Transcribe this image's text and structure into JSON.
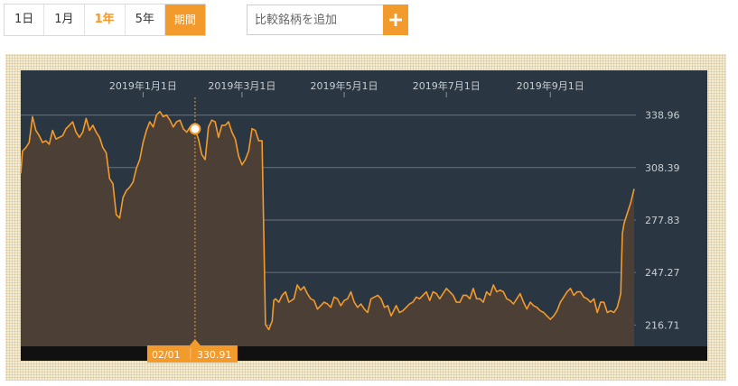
{
  "period_selector": {
    "options": [
      "1日",
      "1月",
      "1年",
      "5年"
    ],
    "active": "1年",
    "custom_label": "期間"
  },
  "add_symbol": {
    "placeholder": "比較銘柄を追加",
    "button_icon": "plus-icon"
  },
  "colors": {
    "accent": "#f39a2c",
    "plot_background": "#2b3643",
    "area_fill": "#4c3f35",
    "gridline": "#6b737c",
    "frame_pattern": "#f4eed7"
  },
  "chart_data": {
    "type": "area",
    "x_tick_labels": [
      "2019年1月1日",
      "2019年3月1日",
      "2019年5月1日",
      "2019年7月1日",
      "2019年9月1日"
    ],
    "y_tick_labels": [
      "338.96",
      "308.39",
      "277.83",
      "247.27",
      "216.71"
    ],
    "y_ticks": [
      338.96,
      308.39,
      277.83,
      247.27,
      216.71
    ],
    "ylim": [
      204.3,
      365
    ],
    "xlim": [
      "2018-10-20",
      "2019-10-21"
    ],
    "grid": true,
    "cursor": {
      "date": "2019-02-01",
      "date_label": "02/01",
      "value_label": "330.91",
      "value": 330.91
    },
    "x": [
      "2018-10-20",
      "2018-10-21",
      "2018-10-23",
      "2018-10-25",
      "2018-10-27",
      "2018-10-29",
      "2018-10-31",
      "2018-11-02",
      "2018-11-04",
      "2018-11-06",
      "2018-11-08",
      "2018-11-10",
      "2018-11-12",
      "2018-11-14",
      "2018-11-16",
      "2018-11-18",
      "2018-11-20",
      "2018-11-22",
      "2018-11-24",
      "2018-11-26",
      "2018-11-28",
      "2018-11-30",
      "2018-12-02",
      "2018-12-04",
      "2018-12-06",
      "2018-12-08",
      "2018-12-10",
      "2018-12-12",
      "2018-12-14",
      "2018-12-16",
      "2018-12-18",
      "2018-12-20",
      "2018-12-22",
      "2018-12-24",
      "2018-12-26",
      "2018-12-28",
      "2018-12-30",
      "2019-01-01",
      "2019-01-03",
      "2019-01-05",
      "2019-01-07",
      "2019-01-09",
      "2019-01-11",
      "2019-01-13",
      "2019-01-15",
      "2019-01-17",
      "2019-01-19",
      "2019-01-21",
      "2019-01-23",
      "2019-01-25",
      "2019-01-27",
      "2019-01-29",
      "2019-02-01",
      "2019-02-03",
      "2019-02-05",
      "2019-02-07",
      "2019-02-09",
      "2019-02-11",
      "2019-02-13",
      "2019-02-15",
      "2019-02-17",
      "2019-02-19",
      "2019-02-21",
      "2019-02-23",
      "2019-02-25",
      "2019-02-27",
      "2019-03-01",
      "2019-03-03",
      "2019-03-05",
      "2019-03-07",
      "2019-03-09",
      "2019-03-11",
      "2019-03-13",
      "2019-03-15",
      "2019-03-17",
      "2019-03-19",
      "2019-03-20",
      "2019-03-21",
      "2019-03-23",
      "2019-03-25",
      "2019-03-27",
      "2019-03-29",
      "2019-04-01",
      "2019-04-03",
      "2019-04-05",
      "2019-04-07",
      "2019-04-09",
      "2019-04-11",
      "2019-04-13",
      "2019-04-15",
      "2019-04-17",
      "2019-04-19",
      "2019-04-21",
      "2019-04-23",
      "2019-04-25",
      "2019-04-27",
      "2019-04-29",
      "2019-05-01",
      "2019-05-03",
      "2019-05-05",
      "2019-05-07",
      "2019-05-09",
      "2019-05-11",
      "2019-05-13",
      "2019-05-15",
      "2019-05-17",
      "2019-05-19",
      "2019-05-21",
      "2019-05-23",
      "2019-05-25",
      "2019-05-27",
      "2019-05-29",
      "2019-06-01",
      "2019-06-03",
      "2019-06-05",
      "2019-06-07",
      "2019-06-09",
      "2019-06-11",
      "2019-06-13",
      "2019-06-15",
      "2019-06-17",
      "2019-06-19",
      "2019-06-21",
      "2019-06-23",
      "2019-06-25",
      "2019-06-27",
      "2019-06-29",
      "2019-07-01",
      "2019-07-03",
      "2019-07-05",
      "2019-07-07",
      "2019-07-09",
      "2019-07-11",
      "2019-07-13",
      "2019-07-15",
      "2019-07-17",
      "2019-07-19",
      "2019-07-21",
      "2019-07-23",
      "2019-07-25",
      "2019-07-27",
      "2019-07-29",
      "2019-07-31",
      "2019-08-02",
      "2019-08-04",
      "2019-08-06",
      "2019-08-08",
      "2019-08-10",
      "2019-08-12",
      "2019-08-14",
      "2019-08-16",
      "2019-08-18",
      "2019-08-20",
      "2019-08-22",
      "2019-08-24",
      "2019-08-26",
      "2019-08-28",
      "2019-08-30",
      "2019-09-01",
      "2019-09-03",
      "2019-09-05",
      "2019-09-07",
      "2019-09-09",
      "2019-09-11",
      "2019-09-13",
      "2019-09-15",
      "2019-09-17",
      "2019-09-19",
      "2019-09-21",
      "2019-09-23",
      "2019-09-25",
      "2019-09-27",
      "2019-09-29",
      "2019-10-01",
      "2019-10-03",
      "2019-10-05",
      "2019-10-07",
      "2019-10-09",
      "2019-10-11",
      "2019-10-13",
      "2019-10-14",
      "2019-10-15",
      "2019-10-17",
      "2019-10-19",
      "2019-10-21"
    ],
    "y": [
      305,
      318,
      320,
      323,
      338,
      330,
      327,
      323,
      324,
      322,
      330,
      325,
      326,
      327,
      331,
      333,
      335,
      329,
      326,
      329,
      337,
      330,
      333,
      329,
      326,
      320,
      317,
      302,
      299,
      281,
      279,
      291,
      295,
      297,
      300,
      308,
      313,
      323,
      330,
      335,
      332,
      339,
      341,
      338,
      339,
      336,
      332,
      335,
      336,
      330.91,
      329,
      332,
      331,
      325,
      316,
      313,
      332,
      336,
      335,
      326,
      333,
      333,
      335,
      329,
      325,
      315,
      310,
      313,
      318,
      331,
      330,
      324,
      324,
      217,
      214,
      219,
      231,
      232,
      230,
      234,
      236,
      230,
      232,
      240,
      237,
      239,
      235,
      232,
      231,
      226,
      228,
      230,
      229,
      227,
      233,
      232,
      228,
      231,
      232,
      236,
      230,
      227,
      229,
      226,
      224,
      232,
      233,
      234,
      232,
      227,
      228,
      222,
      228,
      224,
      225,
      227,
      229,
      230,
      233,
      232,
      234,
      236,
      231,
      236,
      235,
      232,
      235,
      238,
      236,
      234,
      230,
      230,
      234,
      234,
      232,
      238,
      232,
      232,
      230,
      236,
      234,
      240,
      236,
      237,
      236,
      232,
      231,
      229,
      232,
      235,
      230,
      226,
      230,
      228,
      227,
      225,
      224,
      222,
      220,
      222,
      225,
      230,
      233,
      236,
      238,
      234,
      236,
      236,
      233,
      232,
      230,
      232,
      224,
      230,
      230,
      224,
      225,
      224,
      227,
      235,
      270,
      276,
      282,
      288,
      296,
      303,
      301
    ]
  }
}
